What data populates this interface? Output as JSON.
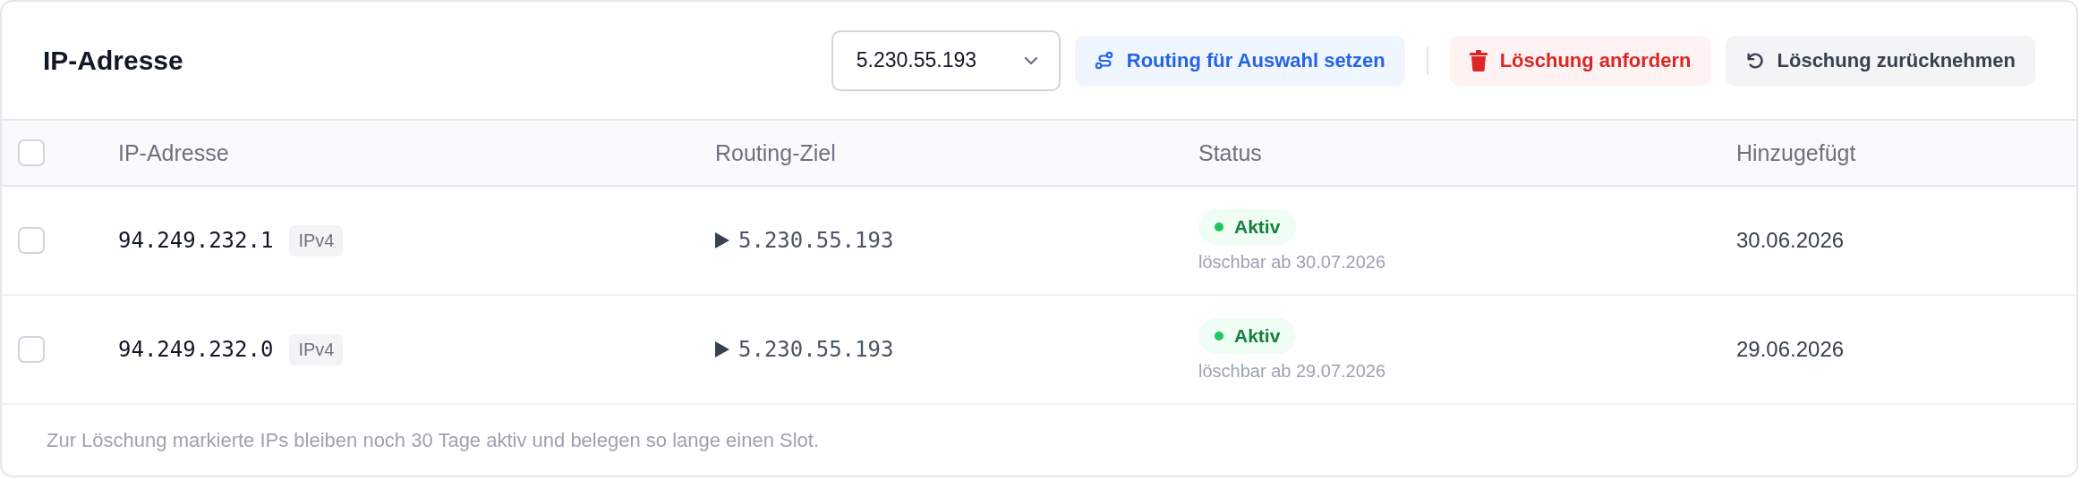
{
  "title": "IP-Adresse",
  "toolbar": {
    "select": {
      "value": "5.230.55.193"
    },
    "buttons": [
      {
        "label": "Routing für Auswahl setzen",
        "kind": "primary"
      },
      {
        "label": "Löschung anfordern",
        "kind": "danger"
      },
      {
        "label": "Löschung zurücknehmen",
        "kind": "neutral"
      }
    ]
  },
  "table": {
    "select_all": {
      "checked": false
    },
    "columns": [
      "IP-Adresse",
      "Routing-Ziel",
      "Status",
      "Hinzugefügt"
    ],
    "rows": [
      {
        "checked": false,
        "ip": "94.249.232.1",
        "family": "IPv4",
        "target": "5.230.55.193",
        "status": {
          "label": "Aktiv",
          "kind": "active"
        },
        "note": "löschbar ab 30.07.2026",
        "added": "30.06.2026"
      },
      {
        "checked": false,
        "ip": "94.249.232.0",
        "family": "IPv4",
        "target": "5.230.55.193",
        "status": {
          "label": "Aktiv",
          "kind": "active"
        },
        "note": "löschbar ab 29.07.2026",
        "added": "29.06.2026"
      }
    ]
  },
  "footer": "Zur Löschung markierte IPs bleiben noch 30 Tage aktiv und belegen so lange einen Slot."
}
